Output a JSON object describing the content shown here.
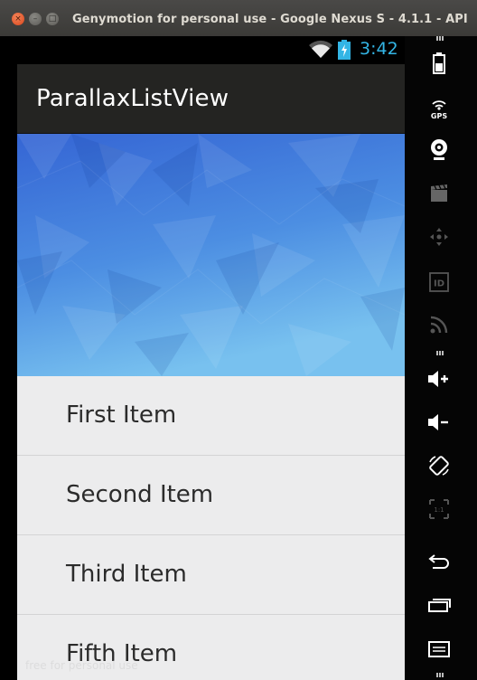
{
  "window": {
    "title": "Genymotion for personal use - Google Nexus S - 4.1.1 - API"
  },
  "statusbar": {
    "time": "3:42",
    "icons": [
      "wifi-icon",
      "battery-icon"
    ],
    "clock_color": "#33b5e5"
  },
  "app": {
    "title": "ParallaxListView",
    "actionbar_color": "#242422",
    "header_image": {
      "colors": [
        "#3a6fd8",
        "#5aa0e8",
        "#7cc2f0"
      ]
    },
    "list": {
      "items": [
        {
          "label": "First Item"
        },
        {
          "label": "Second Item"
        },
        {
          "label": "Third Item"
        },
        {
          "label": "Fifth Item"
        }
      ]
    }
  },
  "watermark": "free for personal use",
  "toolbar": {
    "tools": [
      "battery-icon",
      "gps-icon",
      "webcam-icon",
      "capture-icon",
      "remote-control-icon",
      "device-id-icon",
      "network-icon",
      "volume-up-icon",
      "volume-down-icon",
      "rotate-icon",
      "pixel-perfect-icon",
      "back-icon",
      "recent-apps-icon",
      "menu-icon"
    ],
    "gps_label": "GPS",
    "id_label": "ID",
    "scale_label": "1:1"
  }
}
